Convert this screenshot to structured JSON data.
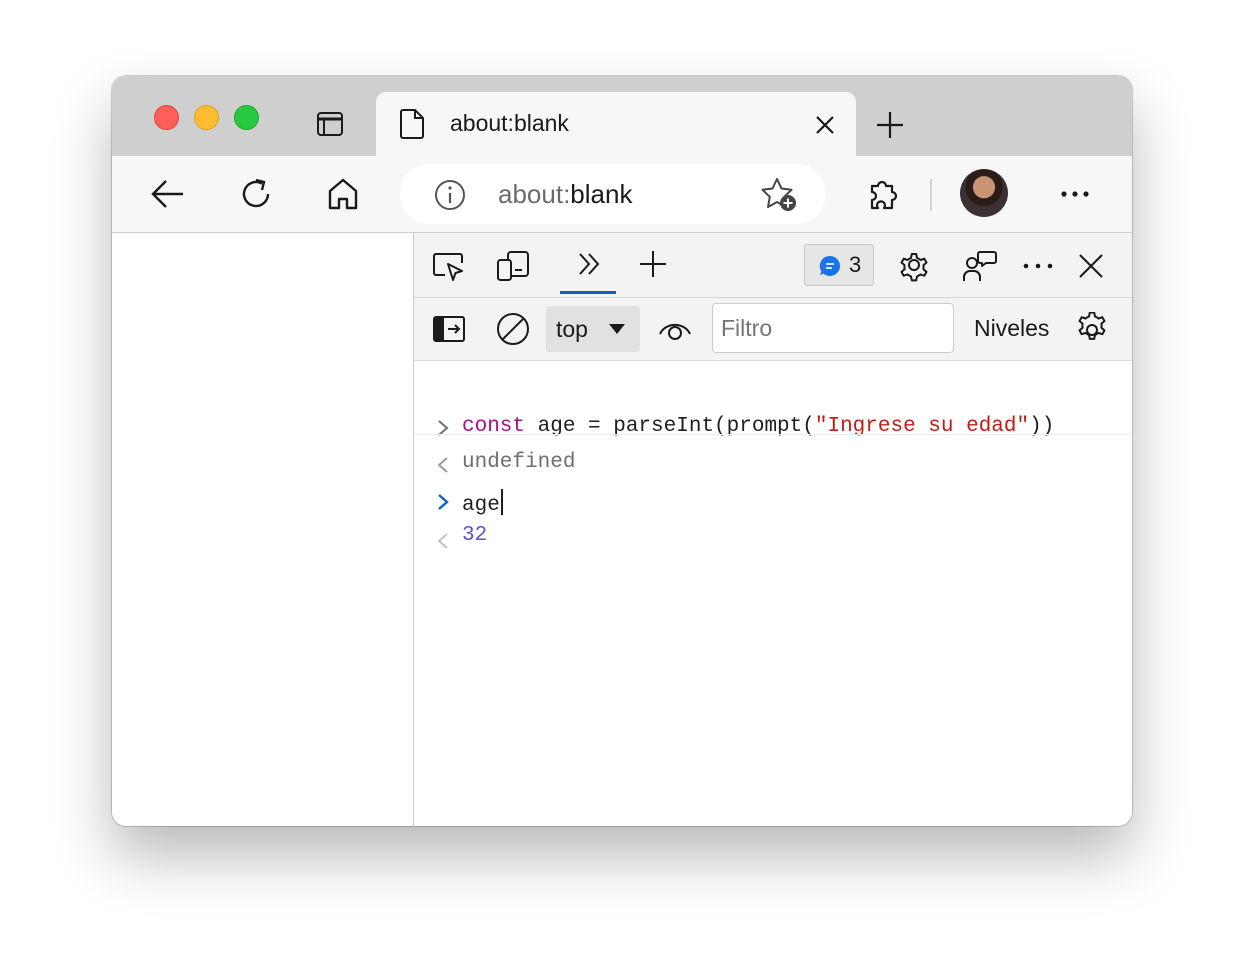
{
  "window": {
    "tab": {
      "title": "about:blank",
      "page_icon": "page-icon",
      "close_icon": "close-icon"
    },
    "new_tab_icon": "plus-icon",
    "tab_actions_icon": "tab-actions-icon"
  },
  "toolbar": {
    "back_icon": "back-arrow-icon",
    "reload_icon": "reload-icon",
    "home_icon": "home-icon",
    "address": {
      "scheme": "about:",
      "rest": "blank",
      "info_icon": "info-icon",
      "favorite_icon": "add-favorite-icon"
    },
    "extensions_icon": "extensions-icon",
    "profile": "avatar",
    "menu_icon": "more-icon"
  },
  "devtools": {
    "top_tabs": {
      "inspect_icon": "inspect-icon",
      "device_icon": "device-emulation-icon",
      "more_tabs_icon": "double-chevron-icon",
      "add_tab_icon": "plus-icon"
    },
    "issues_count": "3",
    "settings_icon": "gear-icon",
    "feedback_icon": "feedback-icon",
    "more_icon": "more-icon",
    "close_icon": "close-icon",
    "console_toolbar": {
      "context": "top",
      "filter_placeholder": "Filtro",
      "levels_label": "Niveles"
    },
    "console": {
      "entries": [
        {
          "type": "input",
          "kw": "const",
          "rest_1": " age = parseInt(prompt(",
          "str": "\"Ingrese su edad\"",
          "rest_2": "))"
        },
        {
          "type": "output",
          "text": "undefined"
        },
        {
          "type": "input",
          "text": "age"
        },
        {
          "type": "output",
          "text": "32"
        }
      ]
    }
  },
  "colors": {
    "keyword": "#aa0d91",
    "string": "#c41a16",
    "number": "#5a55c9",
    "accent": "#0a64c2"
  }
}
